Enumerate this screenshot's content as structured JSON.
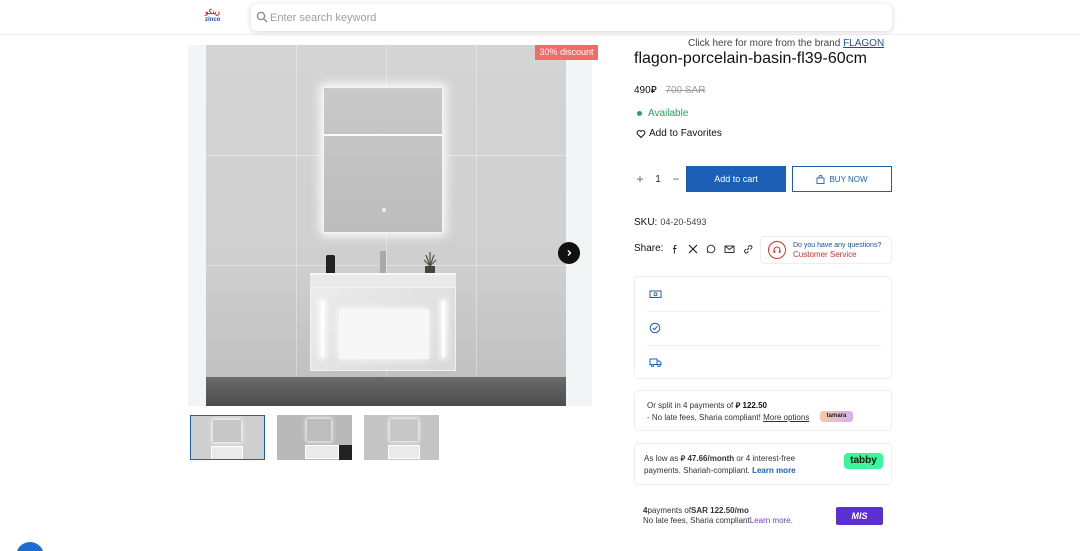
{
  "header": {
    "logo": {
      "line1": "زينكو",
      "line2": "zinco"
    },
    "search": {
      "placeholder": "Enter search keyword",
      "value": ""
    }
  },
  "gallery": {
    "discount_label": "30% discount",
    "thumbnail_count": 3,
    "active_thumbnail": 1
  },
  "product": {
    "brand_prefix": "Click here for more from the brand",
    "brand_name": "FLAGON",
    "title": "flagon-porcelain-basin-fl39-60cm",
    "price": "490",
    "old_price": "700 SAR",
    "availability": "Available",
    "favorites_label": "Add to Favorites",
    "quantity": "1",
    "add_to_cart_label": "Add to cart",
    "buy_now_label": "BUY NOW",
    "sku_label": "SKU:",
    "sku_value": "04-20-5493",
    "share_label": "Share:"
  },
  "customer_service": {
    "question": "Do you have any questions?",
    "label": "Customer Service"
  },
  "tamara": {
    "line1_prefix": "Or split in 4 payments of",
    "amount": "122.50",
    "line2_prefix": "- No late fees, Sharia compliant!",
    "more_options": "More options",
    "badge": "tamara"
  },
  "tabby": {
    "line1_prefix": "As low as",
    "amount": "47.66/month",
    "line1_suffix": "or 4 interest-free",
    "line2_prefix": "payments. Shariah-compliant.",
    "learn_more": "Learn more",
    "badge": "tabby"
  },
  "mis": {
    "count": "4",
    "line1_mid": "payments of",
    "amount": "SAR 122.50/mo",
    "line2_prefix": "No late fees, Sharia compliant",
    "learn_more": "Learn more.",
    "badge": "MIS"
  },
  "colors": {
    "primary": "#1c5fb5",
    "discount": "#f26b6b",
    "available": "#27a35a",
    "service": "#d32f2f",
    "tabby": "#3bf59a",
    "mis": "#5b2fd1"
  }
}
